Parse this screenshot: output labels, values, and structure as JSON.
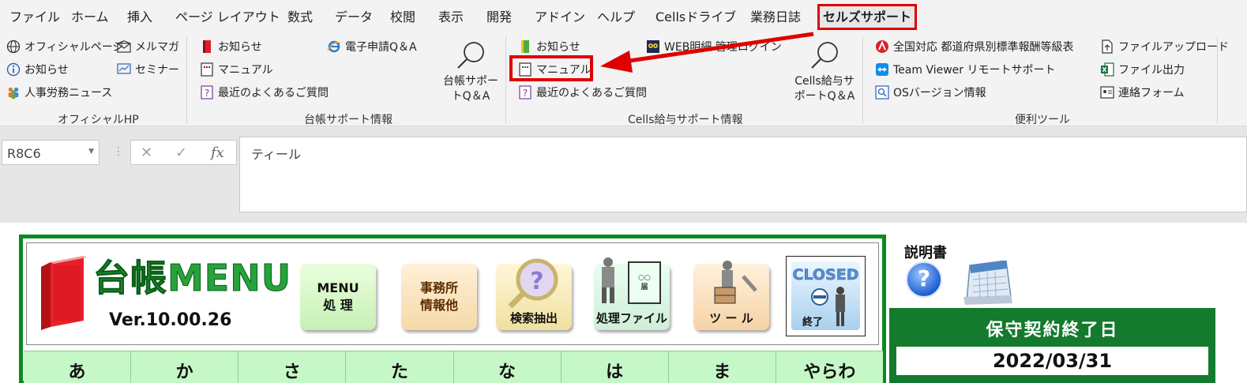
{
  "tabs": [
    "ファイル",
    "ホーム",
    "挿入",
    "ページ レイアウト",
    "数式",
    "データ",
    "校閲",
    "表示",
    "開発",
    "アドイン",
    "ヘルプ",
    "Cellsドライブ",
    "業務日誌",
    "セルズサポート"
  ],
  "active_tab": "セルズサポート",
  "ribbon": {
    "official": {
      "items": [
        "オフィシャルページ",
        "メルマガ",
        "お知らせ",
        "セミナー",
        "人事労務ニュース"
      ],
      "label": "オフィシャルHP"
    },
    "daicho": {
      "items": [
        "お知らせ",
        "マニュアル",
        "最近のよくあるご質問",
        "電子申請Q＆A"
      ],
      "big_button": [
        "台帳サポー",
        "トQ＆A"
      ],
      "label": "台帳サポート情報"
    },
    "cells": {
      "items": [
        "お知らせ",
        "マニュアル",
        "最近のよくあるご質問",
        "WEB明細 管理ログイン"
      ],
      "big_button": [
        "Cells給与サ",
        "ポートQ＆A"
      ],
      "label": "Cells給与サポート情報"
    },
    "tools": {
      "items": [
        "全国対応 都道府県別標準報酬等級表",
        "Team Viewer リモートサポート",
        "OSバージョン情報",
        "ファイルアップロード",
        "ファイル出力",
        "連絡フォーム"
      ],
      "label": "便利ツール"
    }
  },
  "formula_bar": {
    "name_box": "R8C6",
    "cancel": "✕",
    "enter": "✓",
    "fx": "fx",
    "content": "ティール"
  },
  "sheet": {
    "title": "台帳MENU",
    "version": "Ver.10.00.26",
    "buttons": {
      "menu": [
        "MENU",
        "処 理"
      ],
      "office": [
        "事務所",
        "情報他"
      ],
      "search": "検索抽出",
      "file": "処理ファイル",
      "tool": "ツ ー ル",
      "closed": "CLOSED",
      "closed_sub": "終了"
    },
    "kana": [
      "あ",
      "か",
      "さ",
      "た",
      "な",
      "は",
      "ま",
      "やらわ"
    ],
    "manual_label": "説明書",
    "contract_label": "保守契約終了日",
    "contract_date": "2022/03/31"
  }
}
